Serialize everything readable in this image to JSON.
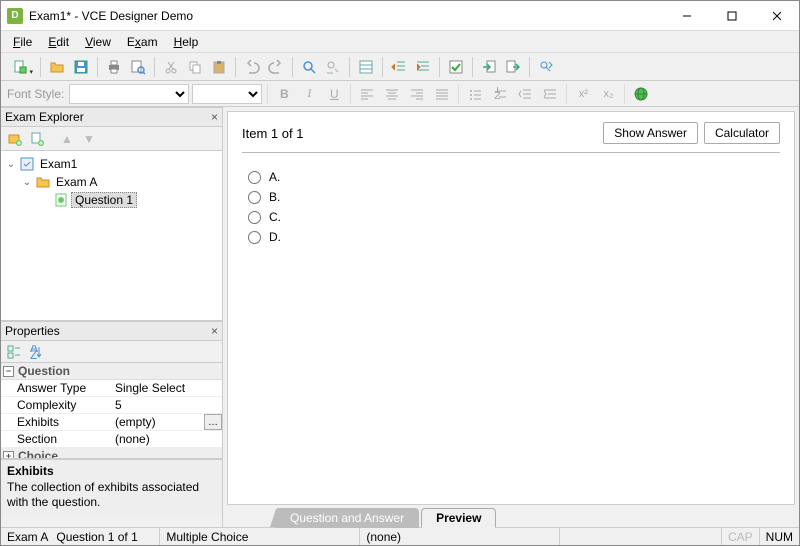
{
  "window": {
    "title": "Exam1* - VCE Designer Demo",
    "app_icon_letter": "D"
  },
  "menu": {
    "file": "File",
    "edit": "Edit",
    "view": "View",
    "exam": "Exam",
    "help": "Help"
  },
  "fontbar": {
    "label": "Font Style:",
    "bold": "B",
    "italic": "I",
    "underline": "U"
  },
  "explorer": {
    "title": "Exam Explorer",
    "root": "Exam1",
    "section": "Exam A",
    "question": "Question 1"
  },
  "properties": {
    "title": "Properties",
    "cat_question": "Question",
    "cat_choice": "Choice",
    "rows": {
      "answer_type_k": "Answer Type",
      "answer_type_v": "Single Select",
      "complexity_k": "Complexity",
      "complexity_v": "5",
      "exhibits_k": "Exhibits",
      "exhibits_v": "(empty)",
      "section_k": "Section",
      "section_v": "(none)"
    },
    "desc_title": "Exhibits",
    "desc_body": "The collection of exhibits associated with the question."
  },
  "preview": {
    "item_label": "Item 1 of 1",
    "show_answer": "Show Answer",
    "calculator": "Calculator",
    "choices": {
      "a": "A.",
      "b": "B.",
      "c": "C.",
      "d": "D."
    }
  },
  "tabs": {
    "qa": "Question and Answer",
    "preview": "Preview"
  },
  "status": {
    "section": "Exam A",
    "question": "Question 1 of 1",
    "type": "Multiple Choice",
    "extra": "(none)",
    "cap": "CAP",
    "num": "NUM"
  }
}
